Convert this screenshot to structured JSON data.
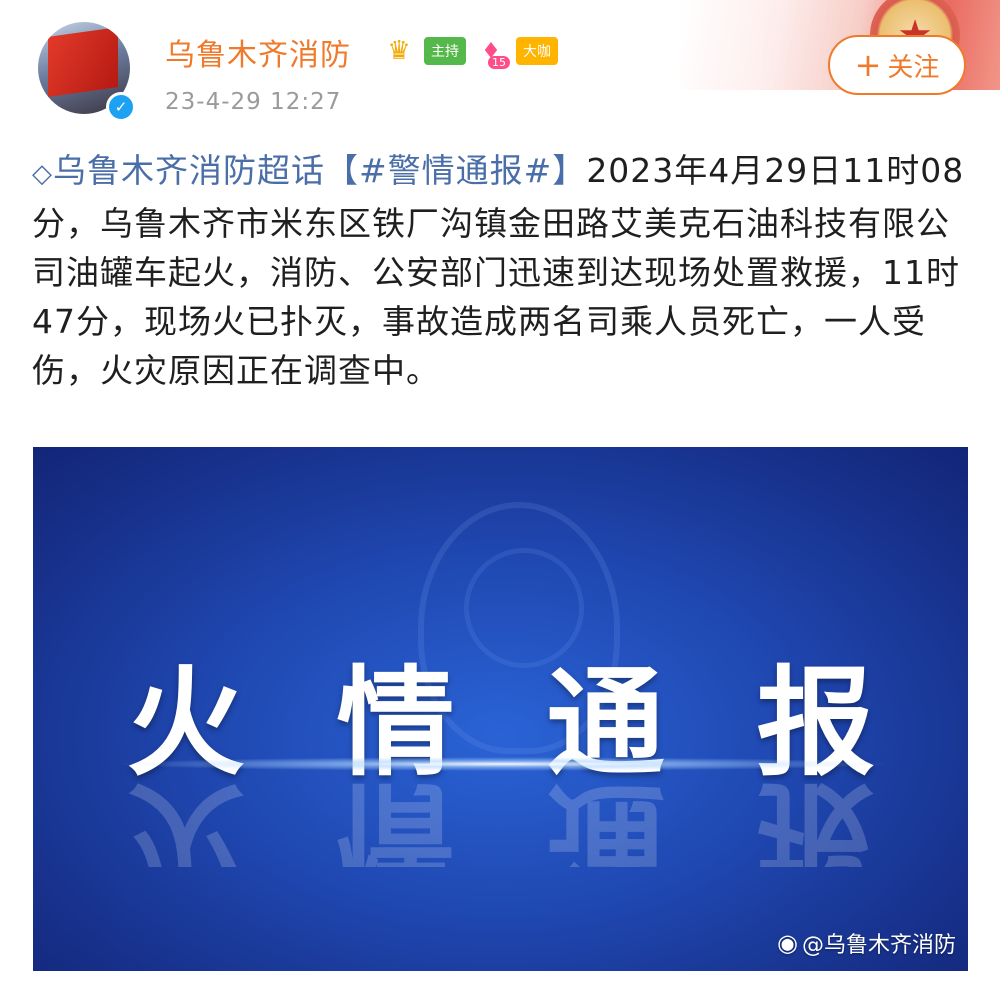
{
  "header": {
    "username": "乌鲁木齐消防",
    "timestamp": "23-4-29 12:27",
    "badges": {
      "host": "主持",
      "level": "15",
      "vip": "大咖"
    },
    "follow_label": "关注",
    "follow_icon": "plus-icon",
    "verified_icon": "verified-check-icon"
  },
  "post": {
    "topic_link": "乌鲁木齐消防超话",
    "hashtag": "【#警情通报#】",
    "text": "2023年4月29日11时08分，乌鲁木齐市米东区铁厂沟镇金田路艾美克石油科技有限公司油罐车起火，消防、公安部门迅速到达现场处置救援，11时47分，现场火已扑灭，事故造成两名司乘人员死亡，一人受伤，火灾原因正在调查中。"
  },
  "image": {
    "title": "火情通报",
    "watermark": "@乌鲁木齐消防"
  },
  "colors": {
    "accent_orange": "#f07a2c",
    "link_blue": "#4a6ea8",
    "image_blue": "#1f47b0"
  }
}
